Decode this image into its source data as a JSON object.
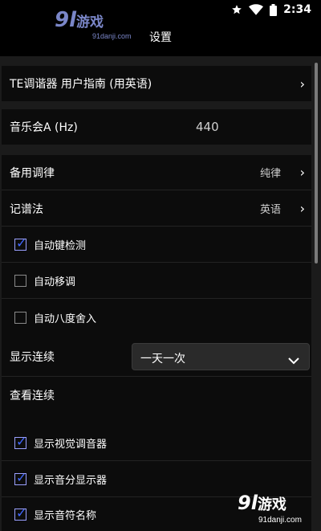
{
  "status_bar": {
    "time": "2:34",
    "icons": [
      "star-icon",
      "wifi-icon",
      "battery-icon"
    ]
  },
  "watermark_top": {
    "number": "9",
    "letter": "l",
    "text": "游戏",
    "url": "91danji.com"
  },
  "header": {
    "title": "设置"
  },
  "guide": {
    "label": "TE调谐器 用户指南 (用英语)",
    "chevron": "›"
  },
  "concert_a": {
    "label": "音乐会A (Hz)",
    "value": "440"
  },
  "alt_tuning": {
    "label": "备用调律",
    "value": "纯律",
    "chevron": "›"
  },
  "notation": {
    "label": "记谱法",
    "value": "英语",
    "chevron": "›"
  },
  "checkboxes_1": [
    {
      "label": "自动键检测",
      "checked": true
    },
    {
      "label": "自动移调",
      "checked": false
    },
    {
      "label": "自动八度舍入",
      "checked": false
    }
  ],
  "show_streak": {
    "label": "显示连续",
    "selected": "一天一次"
  },
  "view_streak": {
    "label": "查看连续"
  },
  "checkboxes_2": [
    {
      "label": "显示视觉调音器",
      "checked": true
    },
    {
      "label": "显示音分显示器",
      "checked": true
    },
    {
      "label": "显示音符名称",
      "checked": true
    }
  ],
  "check_mark": "✓",
  "watermark_bottom": {
    "number": "9",
    "letter": "l",
    "text": "游戏",
    "url": "91danji.com"
  },
  "colors": {
    "background": "#000000",
    "panel": "#0c0c0c",
    "separator": "#1b1b1b",
    "checkbox_accent": "#3f66ff"
  }
}
